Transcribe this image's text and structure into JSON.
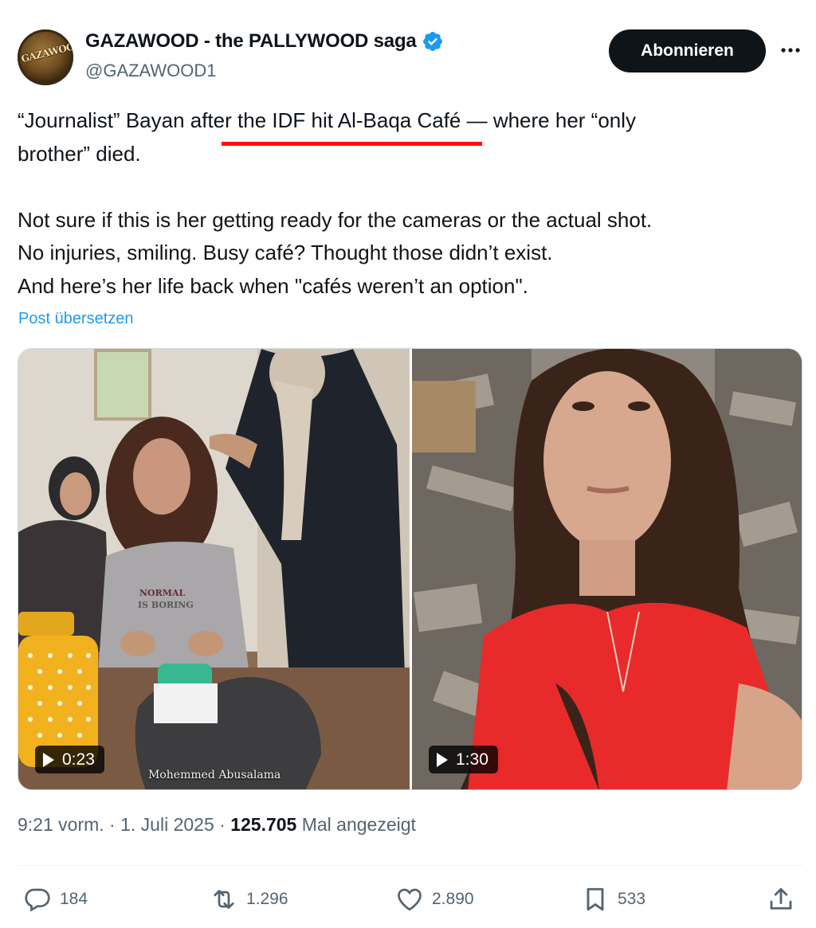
{
  "author": {
    "display_name": "GAZAWOOD - the PALLYWOOD saga",
    "handle": "@GAZAWOOD1",
    "verified": true,
    "avatar_text": "GAZAWOOD",
    "icons": {
      "verified": "verified-badge-icon",
      "more": "more-options-icon"
    }
  },
  "follow_button": "Abonnieren",
  "tweet": {
    "line1_before": "“Journalist” Bayan ",
    "line1_highlight": "after the IDF hit Al-Baqa",
    "line1_after": " Café — where her “only",
    "line2": "brother” died.",
    "para2_line1": "Not sure if this is her getting ready for the cameras or the actual shot.",
    "para2_line2": "No injuries, smiling. Busy café? Thought those didn’t exist.",
    "para2_line3": "And here’s her life back when \"cafés weren’t an option\".",
    "highlight_color": "#ff1010"
  },
  "translate_link": "Post übersetzen",
  "media": {
    "video1": {
      "duration": "0:23",
      "watermark": "Mohemmed Abusalama",
      "shirt_text_1": "NORMAL",
      "shirt_text_2": "IS BORING"
    },
    "video2": {
      "duration": "1:30"
    }
  },
  "meta": {
    "time": "9:21 vorm.",
    "sep": "·",
    "date": "1. Juli 2025",
    "views": "125.705",
    "views_label": "Mal angezeigt"
  },
  "actions": {
    "replies": "184",
    "reposts": "1.296",
    "likes": "2.890",
    "bookmarks": "533",
    "icons": [
      "reply-icon",
      "repost-icon",
      "like-icon",
      "bookmark-icon",
      "share-icon"
    ]
  },
  "colors": {
    "text": "#0f1419",
    "secondary": "#536471",
    "link": "#1d9bf0",
    "button": "#0f1419"
  }
}
